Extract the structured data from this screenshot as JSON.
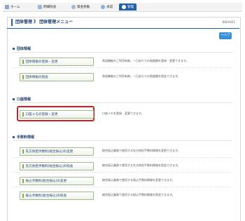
{
  "nav": {
    "tabs": [
      {
        "label": "ホーム",
        "icon": "home-icon",
        "active": false
      },
      {
        "label": "明細照会",
        "icon": "document-icon",
        "active": false
      },
      {
        "label": "資金移動",
        "icon": "transfer-icon",
        "active": false
      },
      {
        "label": "承認",
        "icon": "check-icon",
        "active": false
      },
      {
        "label": "管理",
        "icon": "gear-icon",
        "active": true
      }
    ]
  },
  "header": {
    "breadcrumb": "団体管理 》 団体管理メニュー",
    "screen_code": "BKEA001"
  },
  "help_label": "ヘルプ",
  "sections": [
    {
      "title": "団体情報",
      "items": [
        {
          "label": "団体情報の登録・変更",
          "desc": "承認機能のご利用有無、一日あたりの限度額を登録・変更できます。"
        },
        {
          "label": "団体情報の照会",
          "desc": "承認機能のご利用有無、一日あたりの限度額を照会できます。"
        }
      ]
    },
    {
      "title": "口座情報",
      "items": [
        {
          "label": "口座メモの登録・変更",
          "desc": "口座メモを登録・変更できます。"
        }
      ]
    },
    {
      "title": "手数料情報",
      "items": [
        {
          "label": "先方負担手数料[総合振込]の変更",
          "desc": "総合振込業務で使用する先方負担手数料情報を変更できます。"
        },
        {
          "label": "先方負担手数料[総合振込]の照会",
          "desc": "総合振込業務で使用する先方負担手数料情報を照会できます。"
        },
        {
          "label": "振込手数料[総合振込]の変更",
          "desc": "総合振込業務で使用する振込手数料情報を変更できます。"
        },
        {
          "label": "振込手数料[総合振込]の照会",
          "desc": "総合振込業務で使用する振込手数料情報を照会できます。"
        }
      ]
    }
  ],
  "colors": {
    "brand": "#1f5fae",
    "highlight": "#d21e1e",
    "button_border": "#9fb98a"
  }
}
